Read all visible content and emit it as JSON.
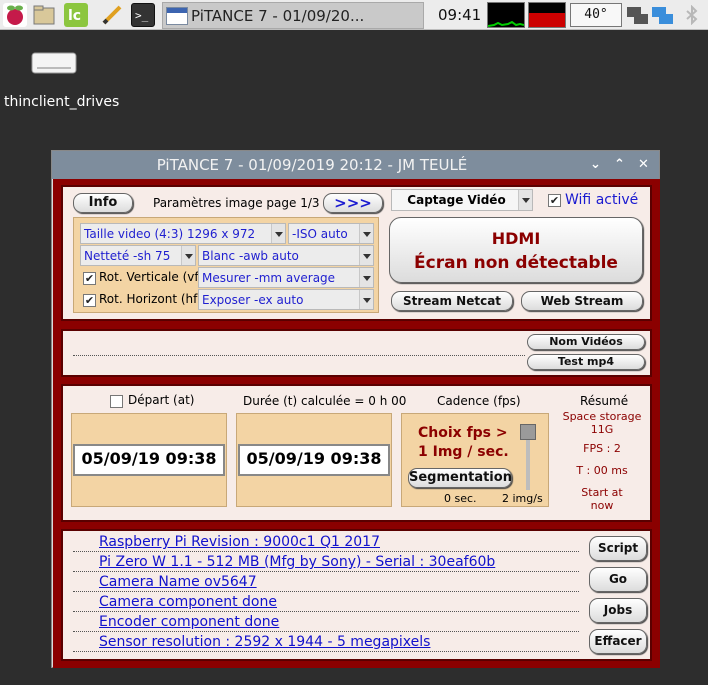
{
  "taskbar": {
    "window_task_title": "PiTANCE 7 - 01/09/20...",
    "clock": "09:41",
    "temperature": "40°",
    "icons": [
      "raspberry-menu-icon",
      "file-manager-icon",
      "libreoffice-calc-icon",
      "text-editor-icon",
      "terminal-icon"
    ],
    "colors": {
      "cpu_monitor": "#00aa00",
      "mem_monitor": "#cc0000"
    }
  },
  "desktop": {
    "drive_label": "thinclient_drives"
  },
  "window": {
    "title": "PiTANCE 7 - 01/09/2019 20:12 - JM TEULÉ",
    "top": {
      "info_button": "Info",
      "page_label": "Paramètres image page 1/3",
      "next_button": ">>>",
      "capture_select": "Captage Vidéo",
      "wifi_label": "Wifi activé",
      "wifi_checked": true,
      "hdmi_title": "HDMI",
      "hdmi_message": "Écran non détectable",
      "stream_netcat_button": "Stream  Netcat",
      "web_stream_button": "Web Stream",
      "settings": {
        "video_size": "Taille video   (4:3) 1296 x 972",
        "iso": "-ISO auto",
        "sharpness": "Netteté -sh 75",
        "white_balance": "Blanc -awb auto",
        "rot_vertical": "Rot. Verticale (vf)",
        "rot_vertical_checked": true,
        "metering": "Mesurer -mm average",
        "rot_horizontal": "Rot. Horizont (hf)",
        "rot_horizontal_checked": true,
        "exposure": "Exposer -ex auto"
      }
    },
    "middle": {
      "video_names_button": "Nom Vidéos",
      "test_mp4_button": "Test mp4"
    },
    "timing": {
      "start_label": "Départ (at)",
      "start_checked": false,
      "duration_label": "Durée (t) calculée = 0 h 00",
      "cadence_label": "Cadence (fps)",
      "summary_label": "Résumé",
      "start_date": "05/09/19  09:38",
      "end_date": "05/09/19  09:38",
      "fps_choice": "Choix fps >",
      "fps_value": "1 Img / sec.",
      "segmentation_button": "Segmentation",
      "slider_min": "0 sec.",
      "slider_max": "2 img/s",
      "slider_value_fraction": 0.0,
      "summary": {
        "storage": "Space storage 11G",
        "fps": "FPS : 2",
        "time": "T : 00 ms",
        "start": "Start at now"
      }
    },
    "info": {
      "lines": [
        "Raspberry Pi Revision : 9000c1 Q1 2017",
        "Pi Zero W 1.1 - 512 MB (Mfg by Sony) - Serial  : 30eaf60b",
        "Camera Name ov5647",
        "Camera component done",
        "Encoder component done",
        "Sensor resolution : 2592 x 1944 - 5 megapixels"
      ],
      "script_button": "Script",
      "go_button": "Go",
      "jobs_button": "Jobs",
      "clear_button": "Effacer"
    }
  }
}
